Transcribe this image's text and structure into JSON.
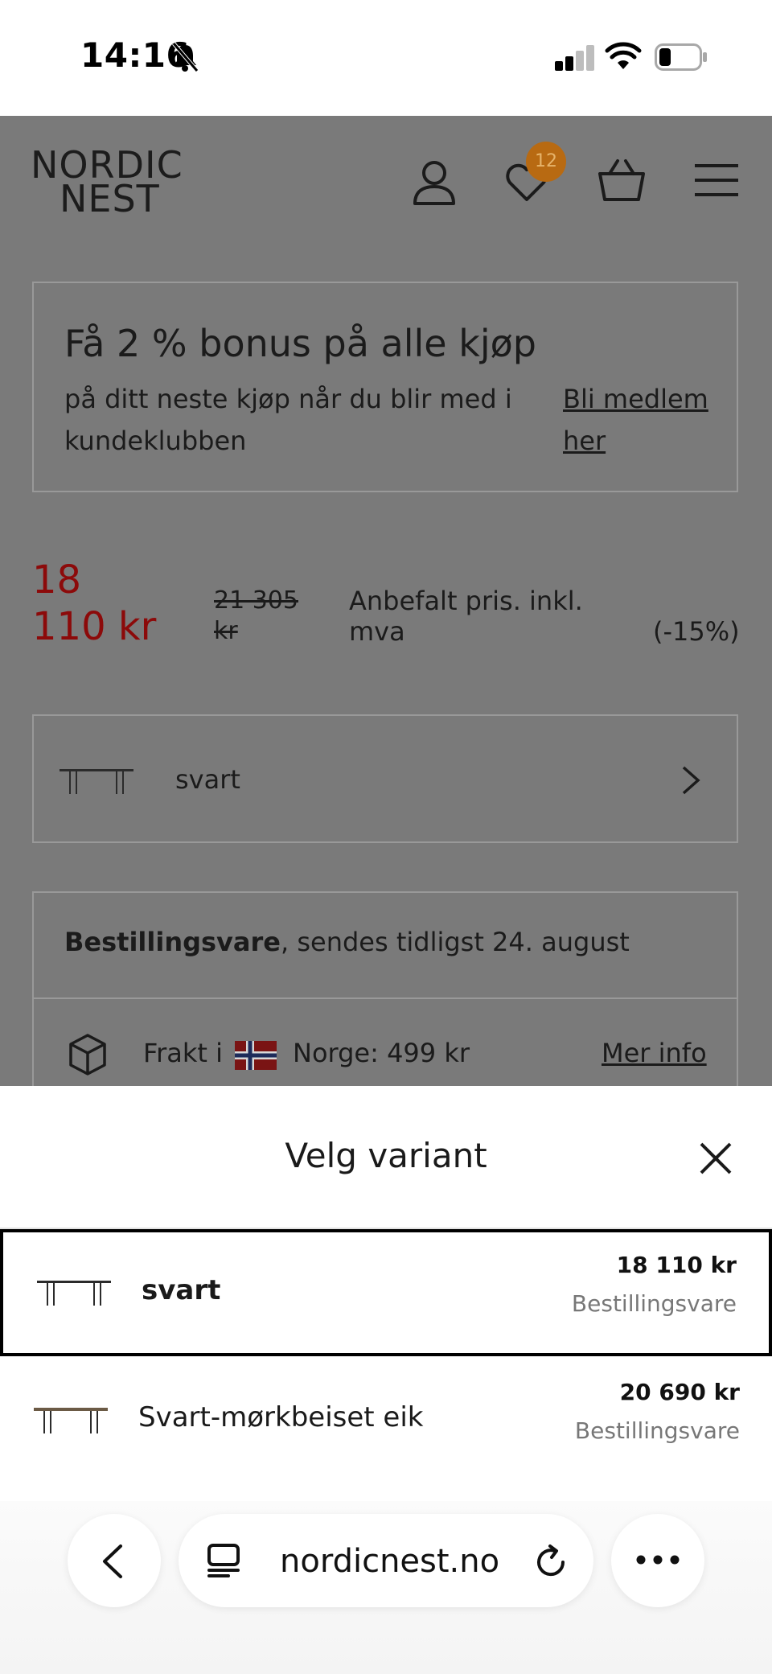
{
  "status_bar": {
    "time": "14:16",
    "icons": [
      "bell-slash-icon",
      "cellular-signal-icon",
      "wifi-icon",
      "battery-icon"
    ]
  },
  "header": {
    "logo_line1": "NORDIC",
    "logo_line2": "NEST",
    "wishlist_count": "12",
    "icons": [
      "user-icon",
      "heart-icon",
      "basket-icon",
      "menu-icon"
    ],
    "badge_color": "#b86a12"
  },
  "bonus": {
    "title": "Få 2 % bonus på alle kjøp",
    "text": "på ditt neste kjøp når du blir med i kundeklubben",
    "link": "Bli medlem her"
  },
  "pricing": {
    "price": "18 110 kr",
    "old_price": "21 305 kr",
    "recommended_label": "Anbefalt pris. inkl. mva",
    "discount": "(-15%)",
    "price_color": "#8c0a0a"
  },
  "selected_variant": {
    "label": "svart"
  },
  "delivery": {
    "status_bold": "Bestillingsvare",
    "status_rest": ", sendes tidligst 24. august",
    "shipping_prefix": "Frakt i",
    "shipping_suffix": "Norge: 499 kr",
    "more_info": "Mer info"
  },
  "sheet": {
    "title": "Velg variant",
    "variants": [
      {
        "name": "svart",
        "price": "18 110 kr",
        "status": "Bestillingsvare",
        "selected": true
      },
      {
        "name": "Svart-mørkbeiset eik",
        "price": "20 690 kr",
        "status": "Bestillingsvare",
        "selected": false
      }
    ]
  },
  "browser": {
    "url": "nordicnest.no",
    "icons": [
      "back-icon",
      "tabs-icon",
      "reload-icon",
      "more-icon"
    ]
  }
}
